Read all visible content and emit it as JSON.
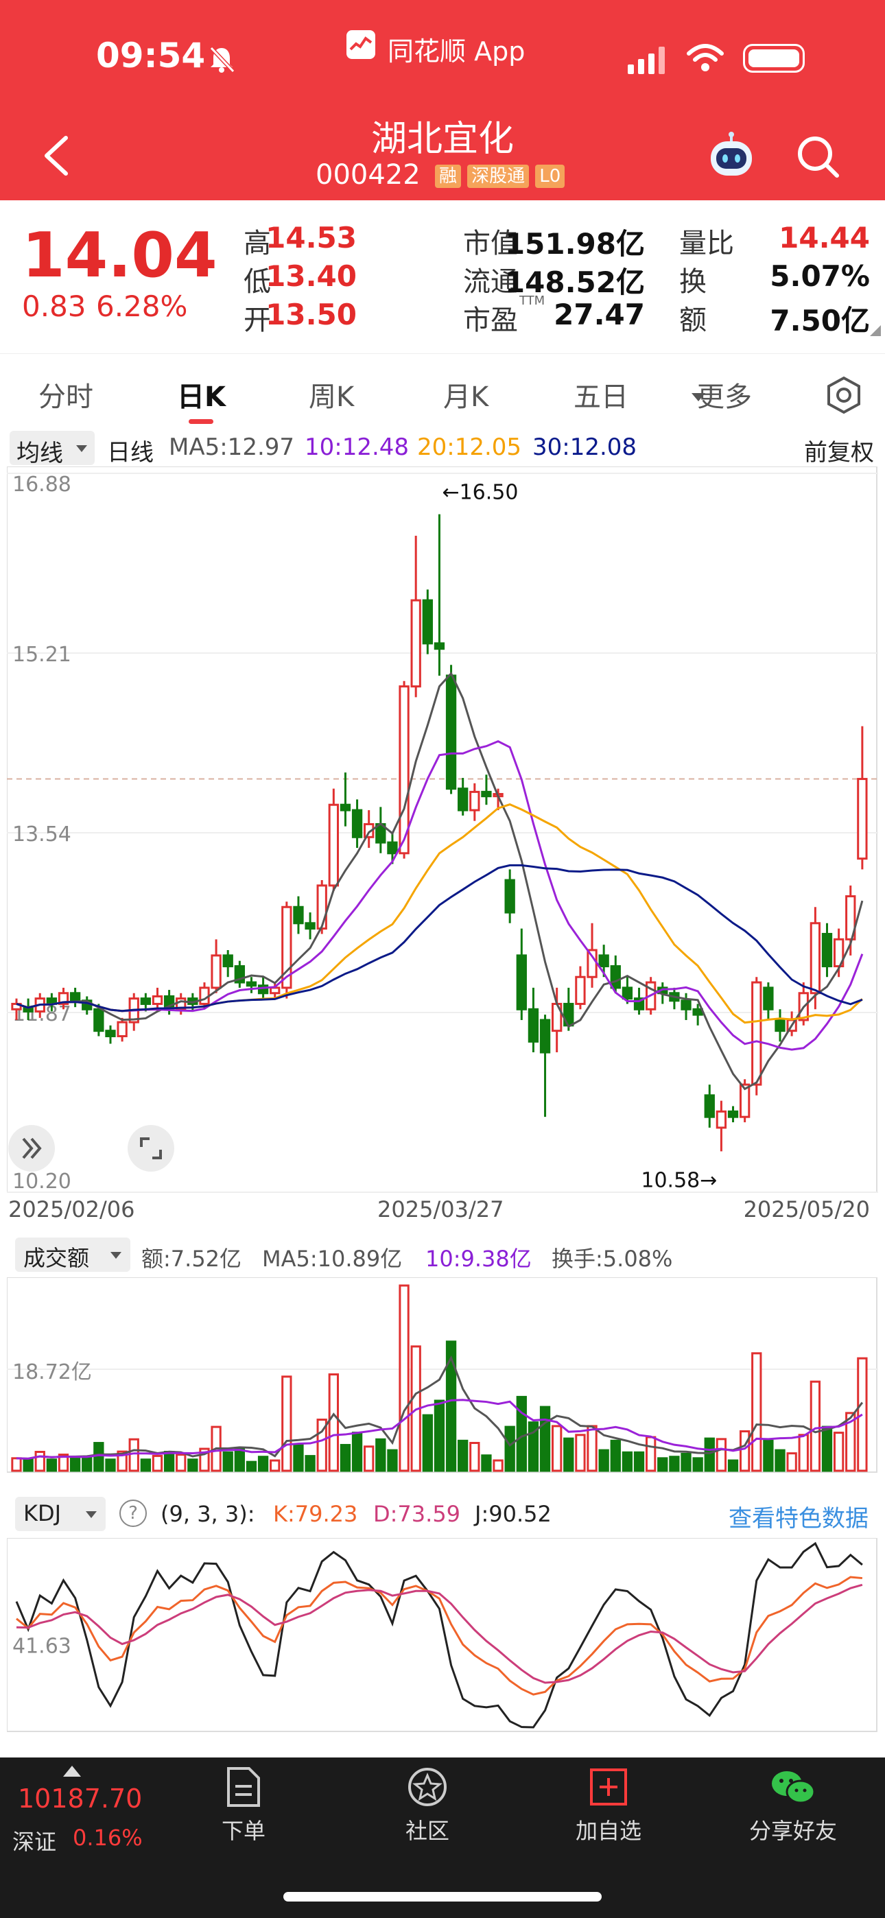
{
  "status_bar": {
    "time": "09:54",
    "app_name": "同花顺 App"
  },
  "header": {
    "stock_name": "湖北宜化",
    "stock_code": "000422",
    "tags": [
      "融",
      "深股通",
      "L0"
    ]
  },
  "quote": {
    "price": "14.04",
    "change": "0.83",
    "change_pct": "6.28%",
    "fields": [
      {
        "label": "高",
        "value": "14.53",
        "color": "#e42b2b"
      },
      {
        "label": "低",
        "value": "13.40",
        "color": "#e42b2b"
      },
      {
        "label": "开",
        "value": "13.50",
        "color": "#e42b2b"
      },
      {
        "label": "市值",
        "value": "151.98亿",
        "color": "#111111"
      },
      {
        "label": "流通",
        "value": "148.52亿",
        "color": "#111111"
      },
      {
        "label": "市盈",
        "sup": "TTM",
        "value": "27.47",
        "color": "#111111"
      },
      {
        "label": "量比",
        "value": "14.44",
        "color": "#e42b2b"
      },
      {
        "label": "换",
        "value": "5.07%",
        "color": "#111111"
      },
      {
        "label": "额",
        "value": "7.50亿",
        "color": "#111111"
      }
    ]
  },
  "tabs": [
    "分时",
    "日K",
    "周K",
    "月K",
    "五日",
    "更多"
  ],
  "active_tab": "日K",
  "ma_bar": {
    "selector": "均线",
    "period": "日线",
    "ma5": "MA5:12.97",
    "ma10": "10:12.48",
    "ma20": "20:12.05",
    "ma30": "30:12.08",
    "adjust": "前复权"
  },
  "colors": {
    "up": "#e03030",
    "down": "#0f7a0f",
    "ma5": "#555555",
    "ma10": "#9b22d8",
    "ma20": "#f5a500",
    "ma30": "#0b1a88",
    "accent": "#ee3a3f"
  },
  "chart_data": [
    {
      "type": "candlestick",
      "x_start": "2025/02/06",
      "x_mid": "2025/03/27",
      "x_end": "2025/05/20",
      "y_ticks": [
        "16.88",
        "15.21",
        "13.54",
        "11.87",
        "10.20"
      ],
      "ylim": [
        10.2,
        16.88
      ],
      "max_label": "←16.50",
      "min_label": "10.58→",
      "current_price": 14.04,
      "candles": [
        [
          11.9,
          11.95,
          11.8,
          12.0
        ],
        [
          11.92,
          11.88,
          11.8,
          12.0
        ],
        [
          11.88,
          12.0,
          11.82,
          12.05
        ],
        [
          12.0,
          11.95,
          11.88,
          12.05
        ],
        [
          11.95,
          12.05,
          11.9,
          12.1
        ],
        [
          12.05,
          11.98,
          11.92,
          12.1
        ],
        [
          11.98,
          11.9,
          11.85,
          12.02
        ],
        [
          11.9,
          11.7,
          11.65,
          11.95
        ],
        [
          11.7,
          11.65,
          11.58,
          11.75
        ],
        [
          11.65,
          11.78,
          11.6,
          11.82
        ],
        [
          11.78,
          12.0,
          11.7,
          12.05
        ],
        [
          12.0,
          11.95,
          11.88,
          12.05
        ],
        [
          11.95,
          12.02,
          11.88,
          12.1
        ],
        [
          12.02,
          11.9,
          11.85,
          12.08
        ],
        [
          11.9,
          12.0,
          11.85,
          12.05
        ],
        [
          12.0,
          11.95,
          11.88,
          12.05
        ],
        [
          11.95,
          12.1,
          11.9,
          12.15
        ],
        [
          12.1,
          12.4,
          12.05,
          12.55
        ],
        [
          12.4,
          12.3,
          12.2,
          12.45
        ],
        [
          12.3,
          12.15,
          12.1,
          12.35
        ],
        [
          12.15,
          12.12,
          12.05,
          12.2
        ],
        [
          12.12,
          12.05,
          12.0,
          12.2
        ],
        [
          12.05,
          12.1,
          12.0,
          12.15
        ],
        [
          12.1,
          12.85,
          12.0,
          12.9
        ],
        [
          12.85,
          12.7,
          12.6,
          12.95
        ],
        [
          12.7,
          12.65,
          12.55,
          12.8
        ],
        [
          12.65,
          13.05,
          12.6,
          13.1
        ],
        [
          13.05,
          13.8,
          13.0,
          13.95
        ],
        [
          13.8,
          13.75,
          13.6,
          14.1
        ],
        [
          13.75,
          13.5,
          13.4,
          13.85
        ],
        [
          13.5,
          13.62,
          13.4,
          13.75
        ],
        [
          13.62,
          13.45,
          13.35,
          13.78
        ],
        [
          13.45,
          13.35,
          13.25,
          13.55
        ],
        [
          13.35,
          14.9,
          13.3,
          14.95
        ],
        [
          14.9,
          15.7,
          14.8,
          16.3
        ],
        [
          15.7,
          15.3,
          15.2,
          15.8
        ],
        [
          15.3,
          15.25,
          15.0,
          16.5
        ],
        [
          15.0,
          13.95,
          13.9,
          15.1
        ],
        [
          13.95,
          13.75,
          13.7,
          14.05
        ],
        [
          13.75,
          13.92,
          13.65,
          14.0
        ],
        [
          13.92,
          13.88,
          13.8,
          14.08
        ],
        [
          13.88,
          13.9,
          13.75,
          13.95
        ],
        [
          13.1,
          12.8,
          12.7,
          13.2
        ],
        [
          12.4,
          11.9,
          11.8,
          12.65
        ],
        [
          11.9,
          11.6,
          11.5,
          12.1
        ],
        [
          11.8,
          11.5,
          10.9,
          11.85
        ],
        [
          11.7,
          11.95,
          11.5,
          12.1
        ],
        [
          11.95,
          11.75,
          11.7,
          12.1
        ],
        [
          11.95,
          12.2,
          11.9,
          12.3
        ],
        [
          12.2,
          12.45,
          12.1,
          12.7
        ],
        [
          12.4,
          12.3,
          12.2,
          12.5
        ],
        [
          12.3,
          12.1,
          12.05,
          12.4
        ],
        [
          12.1,
          12.0,
          11.95,
          12.2
        ],
        [
          12.0,
          11.9,
          11.85,
          12.1
        ],
        [
          11.9,
          12.15,
          11.85,
          12.2
        ],
        [
          12.1,
          12.05,
          11.95,
          12.15
        ],
        [
          12.05,
          11.98,
          11.9,
          12.1
        ],
        [
          11.98,
          11.9,
          11.8,
          12.05
        ],
        [
          11.9,
          11.85,
          11.75,
          11.95
        ],
        [
          11.1,
          10.9,
          10.8,
          11.2
        ],
        [
          10.8,
          10.95,
          10.58,
          11.05
        ],
        [
          10.95,
          10.9,
          10.85,
          11.0
        ],
        [
          10.9,
          11.2,
          10.85,
          11.25
        ],
        [
          11.2,
          12.15,
          11.1,
          12.2
        ],
        [
          12.1,
          11.9,
          11.8,
          12.15
        ],
        [
          11.8,
          11.7,
          11.6,
          11.9
        ],
        [
          11.7,
          11.8,
          11.65,
          11.88
        ],
        [
          11.8,
          12.05,
          11.75,
          12.15
        ],
        [
          12.05,
          12.7,
          11.9,
          12.85
        ],
        [
          12.6,
          12.3,
          12.2,
          12.7
        ],
        [
          12.3,
          12.55,
          12.2,
          12.65
        ],
        [
          12.55,
          12.95,
          12.4,
          13.05
        ],
        [
          13.3,
          14.04,
          13.2,
          14.53
        ]
      ]
    },
    {
      "type": "bar",
      "name": "成交额",
      "selector": "成交额",
      "amount": "额:7.52亿",
      "ma5": "MA5:10.89亿",
      "ma10": "10:9.38亿",
      "turnover": "换手:5.08%",
      "y_tick": "18.72亿"
    },
    {
      "type": "line",
      "name": "KDJ",
      "selector": "KDJ",
      "params": "(9, 3, 3):",
      "k_label": "K:79.23",
      "d_label": "D:73.59",
      "j_label": "J:90.52",
      "link": "查看特色数据",
      "y_tick": "41.63"
    }
  ],
  "footer": {
    "index_value": "10187.70",
    "index_name": "深证",
    "index_change": "0.16%",
    "items": [
      "下单",
      "社区",
      "加自选",
      "分享好友"
    ]
  }
}
